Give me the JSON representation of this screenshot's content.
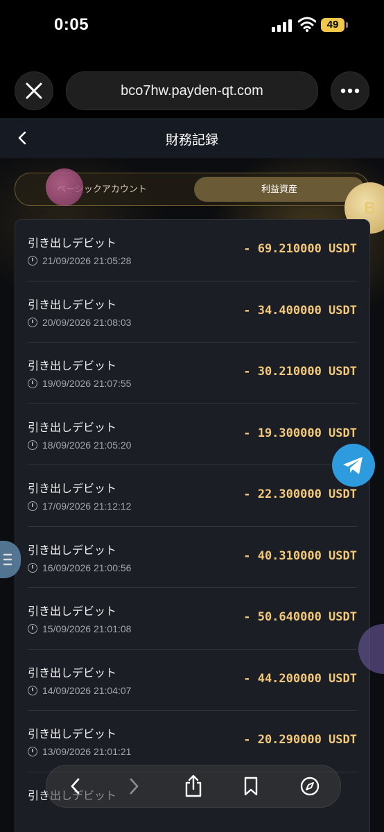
{
  "status_bar": {
    "time": "0:05",
    "battery": "49"
  },
  "browser": {
    "url": "bco7hw.payden-qt.com"
  },
  "page": {
    "title": "財務記録",
    "tabs": [
      {
        "label": "ベーシックアカウント",
        "selected": false
      },
      {
        "label": "利益資産",
        "selected": true
      }
    ],
    "coin_symbol": "B"
  },
  "records": [
    {
      "title": "引き出しデビット",
      "time": "21/09/2026 21:05:28",
      "amount": "- 69.210000 USDT"
    },
    {
      "title": "引き出しデビット",
      "time": "20/09/2026 21:08:03",
      "amount": "- 34.400000 USDT"
    },
    {
      "title": "引き出しデビット",
      "time": "19/09/2026 21:07:55",
      "amount": "- 30.210000 USDT"
    },
    {
      "title": "引き出しデビット",
      "time": "18/09/2026 21:05:20",
      "amount": "- 19.300000 USDT"
    },
    {
      "title": "引き出しデビット",
      "time": "17/09/2026 21:12:12",
      "amount": "- 22.300000 USDT"
    },
    {
      "title": "引き出しデビット",
      "time": "16/09/2026 21:00:56",
      "amount": "- 40.310000 USDT"
    },
    {
      "title": "引き出しデビット",
      "time": "15/09/2026 21:01:08",
      "amount": "- 50.640000 USDT"
    },
    {
      "title": "引き出しデビット",
      "time": "14/09/2026 21:04:07",
      "amount": "- 44.200000 USDT"
    },
    {
      "title": "引き出しデビット",
      "time": "13/09/2026 21:01:21",
      "amount": "- 20.290000 USDT"
    },
    {
      "title": "引き出しデビット",
      "time": "",
      "amount": ""
    }
  ],
  "colors": {
    "amount": "#f3c979",
    "accent_gold": "#6b5a36",
    "telegram": "#2d9bde"
  }
}
